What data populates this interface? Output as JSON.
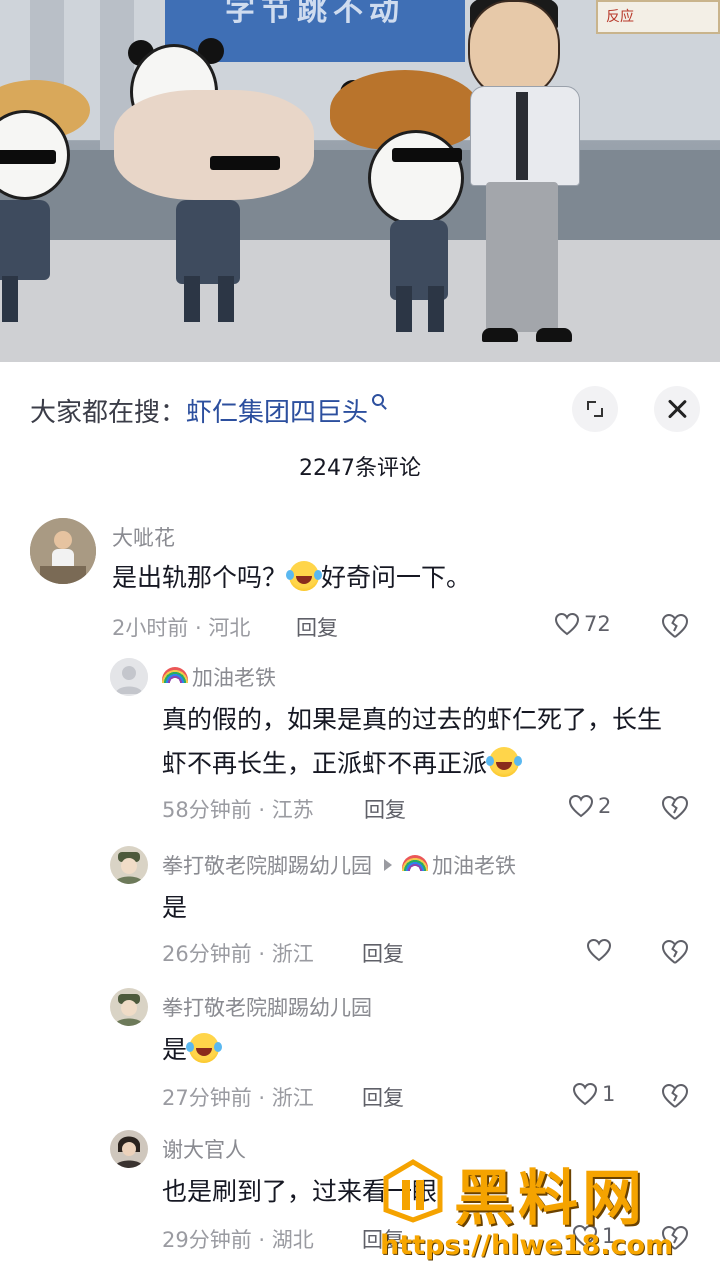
{
  "video": {
    "banner_text": "字节跳不动",
    "sign_text": "反应"
  },
  "panel": {
    "search_prefix": "大家都在搜：",
    "search_term": "虾仁集团四巨头",
    "comment_count_title": "2247条评论"
  },
  "comments": [
    {
      "username": "大呲花",
      "text_before": "是出轨那个吗？",
      "text_after": "好奇问一下。",
      "time_location": "2小时前 · 河北",
      "reply_label": "回复",
      "likes": "72"
    },
    {
      "username": "加油老铁",
      "text": "真的假的，如果是真的过去的虾仁死了，长生虾不再长生，正派虾不再正派",
      "time_location": "58分钟前 · 江苏",
      "reply_label": "回复",
      "likes": "2"
    },
    {
      "username": "拳打敬老院脚踢幼儿园",
      "reply_to": "加油老铁",
      "text": "是",
      "time_location": "26分钟前 · 浙江",
      "reply_label": "回复",
      "likes": ""
    },
    {
      "username": "拳打敬老院脚踢幼儿园",
      "text": "是",
      "time_location": "27分钟前 · 浙江",
      "reply_label": "回复",
      "likes": "1"
    },
    {
      "username": "谢大官人",
      "text": "也是刷到了，过来看一眼",
      "time_location": "29分钟前 · 湖北",
      "reply_label": "回复",
      "likes": "1"
    }
  ],
  "watermark": {
    "brand": "黑料网",
    "url": "https://hlwe18.com"
  },
  "colors": {
    "accent_link": "#2c4f9e",
    "watermark": "#f5a300"
  },
  "icons": [
    "search-icon",
    "expand-icon",
    "close-icon",
    "heart-icon",
    "dislike-icon",
    "rainbow-icon",
    "laughing-crying-emoji"
  ]
}
